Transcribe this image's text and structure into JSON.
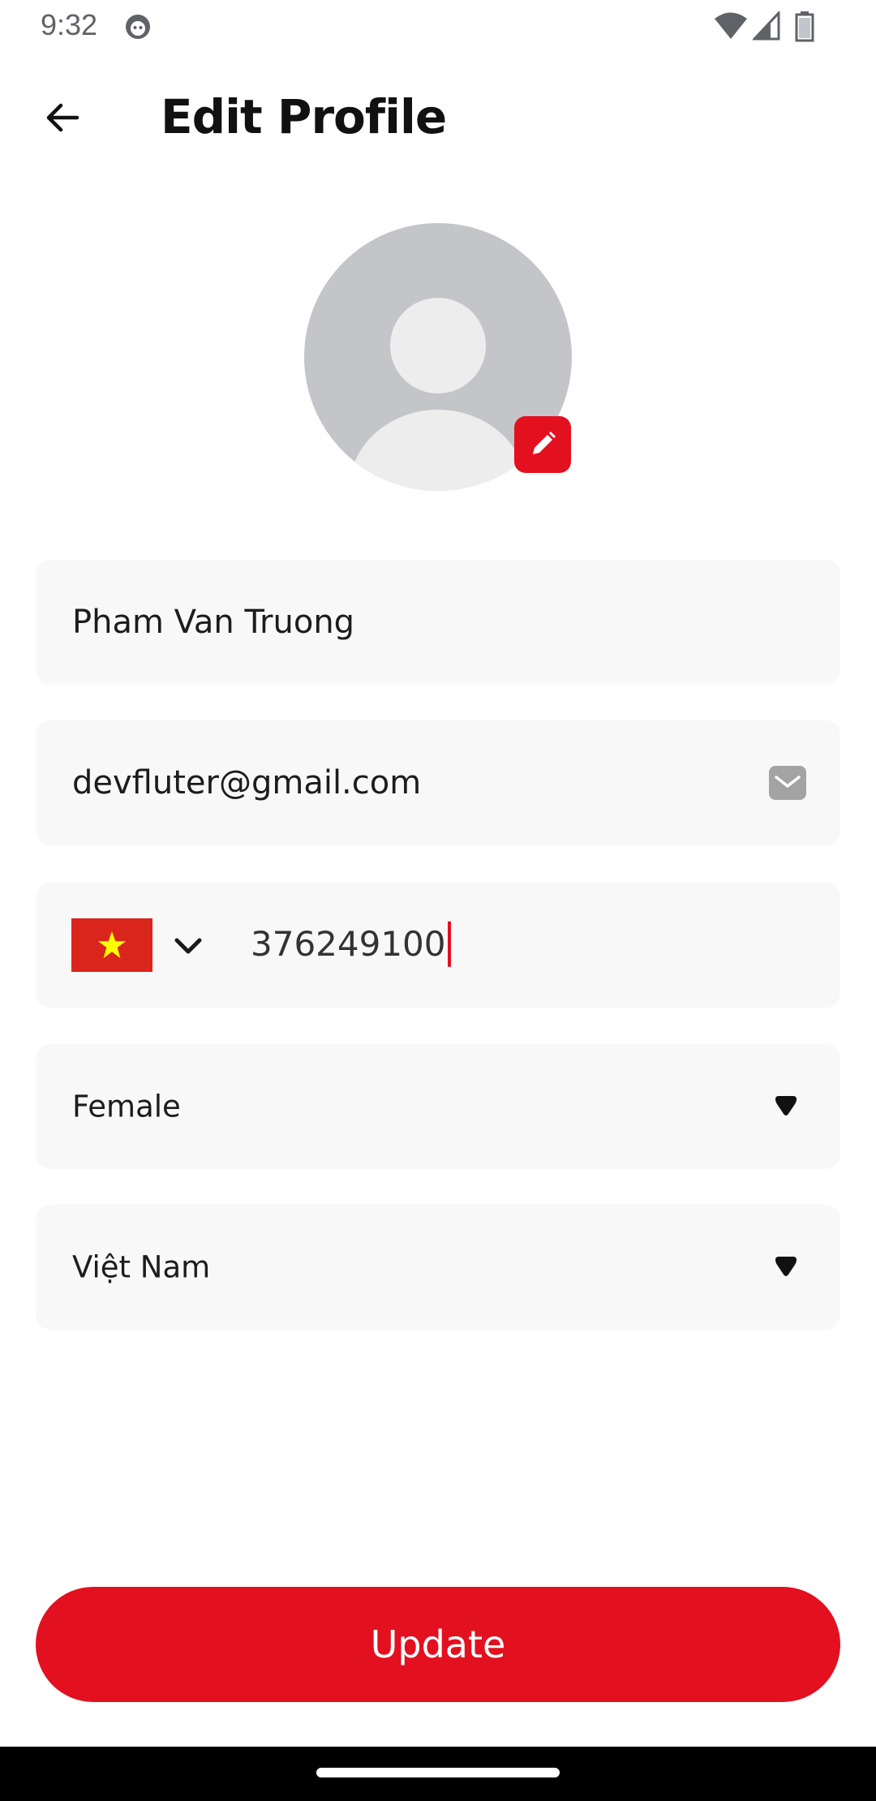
{
  "status_bar": {
    "time": "9:32"
  },
  "header": {
    "title": "Edit Profile"
  },
  "form": {
    "name": "Pham Van Truong",
    "email": "devfluter@gmail.com",
    "phone_number": "376249100",
    "gender": "Female",
    "country": "Việt Nam"
  },
  "update_button_label": "Update",
  "colors": {
    "accent": "#e31020",
    "field_background": "#f8f8f8",
    "flag_red": "#da251d",
    "flag_star": "#ffff00"
  },
  "icons": {
    "back": "arrow-left-icon",
    "edit_avatar": "pencil-icon",
    "email": "mail-icon",
    "phone_country": "vietnam-flag-icon",
    "country_picker": "chevron-down-icon",
    "dropdown": "caret-down-icon"
  }
}
